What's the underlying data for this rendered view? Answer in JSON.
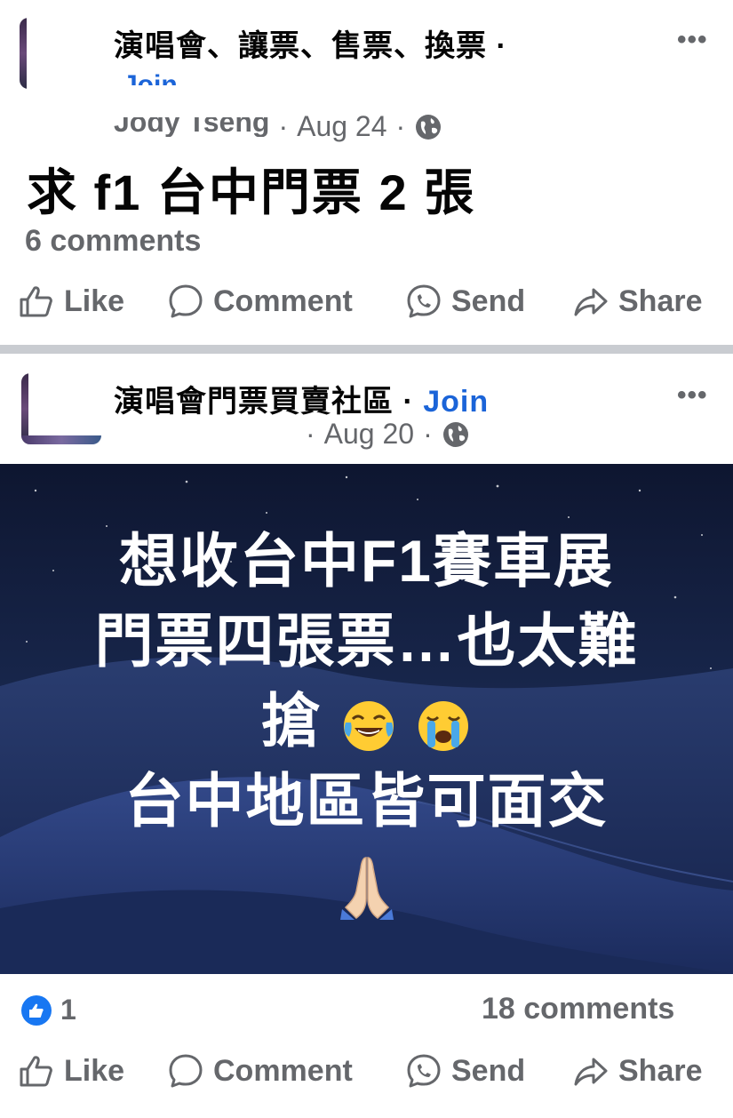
{
  "post1": {
    "group_name": "演唱會、讓票、售票、換票 ·",
    "join_label": "Join",
    "author": "Jody Tseng",
    "date": "Aug 24",
    "text": "求 f1 台中門票 2 張",
    "comments": "6 comments",
    "actions": {
      "like": "Like",
      "comment": "Comment",
      "send": "Send",
      "share": "Share"
    }
  },
  "post2": {
    "group_name": "演唱會門票買賣社區 ·",
    "join_label": "Join",
    "date": "Aug 20",
    "image_text": {
      "line1": "想收台中F1賽車展",
      "line2": "門票四張票…也太難",
      "line3": "搶",
      "line4": "台中地區皆可面交"
    },
    "reaction_count": "1",
    "comments": "18 comments",
    "actions": {
      "like": "Like",
      "comment": "Comment",
      "send": "Send",
      "share": "Share"
    }
  },
  "icons": {
    "globe": "globe-icon",
    "more": "more-options-icon",
    "like": "thumbs-up-icon",
    "comment": "comment-bubble-icon",
    "send": "messenger-icon",
    "share": "share-arrow-icon",
    "emoji1": "tears-of-joy-emoji",
    "emoji2": "loudly-crying-emoji",
    "emoji3": "folded-hands-emoji"
  },
  "colors": {
    "join": "#1b64d8",
    "secondary_text": "#65676b",
    "like_blue": "#1877f2",
    "separator": "#c9ccd1"
  }
}
